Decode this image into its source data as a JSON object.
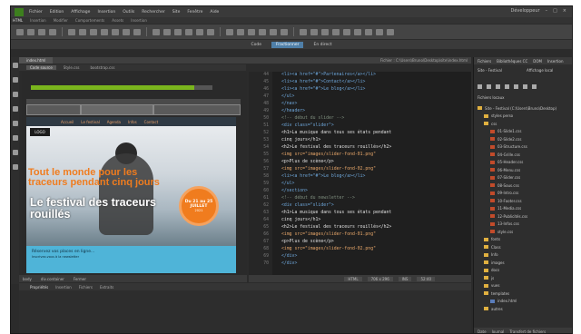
{
  "menubar": {
    "items": [
      "Fichier",
      "Edition",
      "Affichage",
      "Insertion",
      "Outils",
      "Rechercher",
      "Site",
      "Fenêtre",
      "Aide"
    ],
    "workspace": "Développeur"
  },
  "doc_tabs": [
    "HTML",
    "Insertion",
    "Modifier",
    "Comportements",
    "Assets",
    "Insertion"
  ],
  "codebar": {
    "code": "Code",
    "split": "Fractionner",
    "live": "En direct"
  },
  "file_tab": {
    "name": "index.html",
    "path": "Fichier : C:\\Users\\Bruno\\Desktop\\site\\index.html"
  },
  "related_tabs": [
    "Code source",
    "Style.css",
    "bootstrap.css"
  ],
  "live_view": {
    "progress_percent": 90,
    "logo": "LOGO",
    "nav": [
      "Accueil",
      "Le festival",
      "Agenda",
      "Infos",
      "Contact"
    ],
    "headline_orange": "Tout le monde pour les traceurs pendant cinq jours",
    "headline_white": "Le festival des traceurs rouillés",
    "badge_line1": "Du 21 au 25",
    "badge_line2": "JUILLET",
    "badge_line3": "2021",
    "newsletter_title": "Réservez vos places en ligne...",
    "newsletter_sub": "Inscrivez-vous à la newsletter"
  },
  "code_lines": [
    {
      "n": "44",
      "text": "<li><a href=\"#\">Partenaires</a></li>",
      "kind": "tag"
    },
    {
      "n": "45",
      "text": "<li><a href=\"#\">Contact</a></li>",
      "kind": "tag"
    },
    {
      "n": "46",
      "text": "<li><a href=\"#\">Le blog</a></li>",
      "kind": "tag"
    },
    {
      "n": "47",
      "text": "</ul>",
      "kind": "tag"
    },
    {
      "n": "48",
      "text": "</nav>",
      "kind": "tag"
    },
    {
      "n": "49",
      "text": "</header>",
      "kind": "tag"
    },
    {
      "n": "50",
      "text": "<!-- début du slider -->",
      "kind": "com"
    },
    {
      "n": "51",
      "text": "<div class=\"slider\">",
      "kind": "tag"
    },
    {
      "n": "52",
      "text": "<h1>La musique dans tous ses états pendant",
      "kind": "code"
    },
    {
      "n": "53",
      "text": "cinq jours</h1>",
      "kind": "code"
    },
    {
      "n": "54",
      "text": "<h2>Le festival des traceurs rouillés</h2>",
      "kind": "code"
    },
    {
      "n": "55",
      "text": "<img src=\"images/slider-fond-01.png\"",
      "kind": "str"
    },
    {
      "n": "56",
      "text": "<p>Plus de scène</p>",
      "kind": "code"
    },
    {
      "n": "57",
      "text": "<img src=\"images/slider-fond-02.png\"",
      "kind": "str"
    },
    {
      "n": "58",
      "text": "<li><a href=\"#\">Le blog</a></li>",
      "kind": "tag"
    },
    {
      "n": "59",
      "text": "</ul>",
      "kind": "tag"
    },
    {
      "n": "60",
      "text": "</section>",
      "kind": "tag"
    },
    {
      "n": "61",
      "text": "<!-- début du newsletter -->",
      "kind": "com"
    },
    {
      "n": "62",
      "text": "<div class=\"slider\">",
      "kind": "tag"
    },
    {
      "n": "63",
      "text": "<h1>La musique dans tous ses états pendant",
      "kind": "code"
    },
    {
      "n": "64",
      "text": "cinq jours</h1>",
      "kind": "code"
    },
    {
      "n": "65",
      "text": "<h2>Le festival des traceurs rouillés</h2>",
      "kind": "code"
    },
    {
      "n": "66",
      "text": "<img src=\"images/slider-fond-01.png\"",
      "kind": "str"
    },
    {
      "n": "67",
      "text": "<p>Plus de scène</p>",
      "kind": "code"
    },
    {
      "n": "68",
      "text": "<img src=\"images/slider-fond-02.png\"",
      "kind": "str"
    },
    {
      "n": "69",
      "text": "</div>",
      "kind": "tag"
    },
    {
      "n": "70",
      "text": "</div>",
      "kind": "tag"
    }
  ],
  "live_bottom": [
    "body",
    "div.container",
    "Fermer"
  ],
  "status": {
    "lang": "HTML",
    "size": "706 x 296",
    "ins": "INS",
    "pos": "52:40"
  },
  "properties_tabs": [
    "Propriétés",
    "Insertion",
    "Fichiers",
    "Extraits"
  ],
  "right_panel": {
    "tabs": [
      "Fichiers",
      "Bibliothèques CC",
      "DOM",
      "Insertion"
    ],
    "site_label": "Site - Festival",
    "view_label": "Affichage local",
    "local_files": "Fichiers locaux",
    "tree": [
      {
        "label": "Site - Festival (C:\\Users\\Bruno\\Desktop)",
        "type": "folder",
        "indent": 0
      },
      {
        "label": "styles perso",
        "type": "folder",
        "indent": 1
      },
      {
        "label": "css",
        "type": "folder",
        "indent": 1
      },
      {
        "label": "01-Slide1.css",
        "type": "file",
        "indent": 2
      },
      {
        "label": "02-Slide2.css",
        "type": "file",
        "indent": 2
      },
      {
        "label": "03-Structure.css",
        "type": "file",
        "indent": 2
      },
      {
        "label": "04-Grille.css",
        "type": "file",
        "indent": 2
      },
      {
        "label": "05-Header.css",
        "type": "file",
        "indent": 2
      },
      {
        "label": "06-Menu.css",
        "type": "file",
        "indent": 2
      },
      {
        "label": "07-Slider.css",
        "type": "file",
        "indent": 2
      },
      {
        "label": "08-Sous.css",
        "type": "file",
        "indent": 2
      },
      {
        "label": "09-Intro.css",
        "type": "file",
        "indent": 2
      },
      {
        "label": "10-Footer.css",
        "type": "file",
        "indent": 2
      },
      {
        "label": "11-Media.css",
        "type": "file",
        "indent": 2
      },
      {
        "label": "12-Publicités.css",
        "type": "file",
        "indent": 2
      },
      {
        "label": "13-Infos.css",
        "type": "file",
        "indent": 2
      },
      {
        "label": "style.css",
        "type": "file",
        "indent": 2
      },
      {
        "label": "fonts",
        "type": "folder",
        "indent": 1
      },
      {
        "label": "Class",
        "type": "folder",
        "indent": 1
      },
      {
        "label": "Info",
        "type": "folder",
        "indent": 1
      },
      {
        "label": "images",
        "type": "folder",
        "indent": 1
      },
      {
        "label": "docs",
        "type": "folder",
        "indent": 1
      },
      {
        "label": "js",
        "type": "folder",
        "indent": 1
      },
      {
        "label": "vues",
        "type": "folder",
        "indent": 1
      },
      {
        "label": "templates",
        "type": "folder",
        "indent": 1
      },
      {
        "label": "index.html",
        "type": "html",
        "indent": 2
      },
      {
        "label": "autres",
        "type": "folder",
        "indent": 1
      }
    ],
    "footer": [
      "Date",
      "Journal",
      "Transfert de fichiers"
    ]
  }
}
